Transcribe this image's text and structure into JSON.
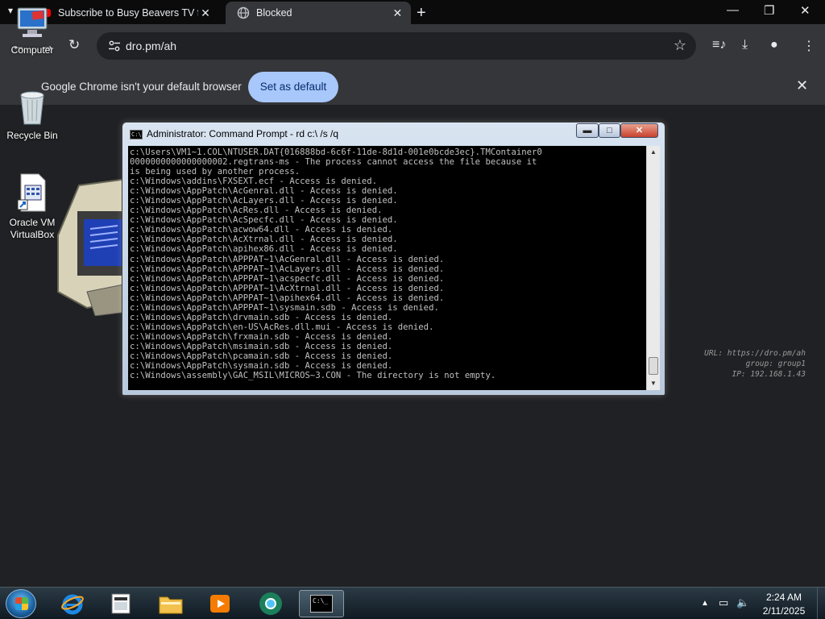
{
  "browser": {
    "tabs": [
      {
        "title": "Subscribe to Busy Beavers TV fo",
        "active": false
      },
      {
        "title": "Blocked",
        "active": true
      }
    ],
    "url": "dro.pm/ah",
    "infobar": {
      "message": "Google Chrome isn't your default browser",
      "button": "Set as default"
    }
  },
  "desktop": {
    "icons": [
      {
        "label": "Computer"
      },
      {
        "label": "Recycle Bin"
      },
      {
        "label": "Oracle VM VirtualBox"
      }
    ],
    "watermark": {
      "url": "URL: https://dro.pm/ah",
      "group": "group: group1",
      "ip": "IP: 192.168.1.43"
    }
  },
  "cmd": {
    "title": "Administrator:  Command Prompt - rd  c:\\ /s /q",
    "lines": [
      "c:\\Users\\VM1~1.COL\\NTUSER.DAT{016888bd-6c6f-11de-8d1d-001e0bcde3ec}.TMContainer0",
      "0000000000000000002.regtrans-ms - The process cannot access the file because it",
      "is being used by another process.",
      "c:\\Windows\\addins\\FXSEXT.ecf - Access is denied.",
      "c:\\Windows\\AppPatch\\AcGenral.dll - Access is denied.",
      "c:\\Windows\\AppPatch\\AcLayers.dll - Access is denied.",
      "c:\\Windows\\AppPatch\\AcRes.dll - Access is denied.",
      "c:\\Windows\\AppPatch\\AcSpecfc.dll - Access is denied.",
      "c:\\Windows\\AppPatch\\acwow64.dll - Access is denied.",
      "c:\\Windows\\AppPatch\\AcXtrnal.dll - Access is denied.",
      "c:\\Windows\\AppPatch\\apihex86.dll - Access is denied.",
      "c:\\Windows\\AppPatch\\APPPAT~1\\AcGenral.dll - Access is denied.",
      "c:\\Windows\\AppPatch\\APPPAT~1\\AcLayers.dll - Access is denied.",
      "c:\\Windows\\AppPatch\\APPPAT~1\\acspecfc.dll - Access is denied.",
      "c:\\Windows\\AppPatch\\APPPAT~1\\AcXtrnal.dll - Access is denied.",
      "c:\\Windows\\AppPatch\\APPPAT~1\\apihex64.dll - Access is denied.",
      "c:\\Windows\\AppPatch\\APPPAT~1\\sysmain.sdb - Access is denied.",
      "c:\\Windows\\AppPatch\\drvmain.sdb - Access is denied.",
      "c:\\Windows\\AppPatch\\en-US\\AcRes.dll.mui - Access is denied.",
      "c:\\Windows\\AppPatch\\frxmain.sdb - Access is denied.",
      "c:\\Windows\\AppPatch\\msimain.sdb - Access is denied.",
      "c:\\Windows\\AppPatch\\pcamain.sdb - Access is denied.",
      "c:\\Windows\\AppPatch\\sysmain.sdb - Access is denied.",
      "c:\\Windows\\assembly\\GAC_MSIL\\MICROS~3.CON - The directory is not empty."
    ]
  },
  "taskbar": {
    "clock_time": "2:24 AM",
    "clock_date": "2/11/2025",
    "cmd_button_label": "C:\\_"
  },
  "colors": {
    "chrome_bg": "#202124",
    "infobar_button": "#a8c7fa",
    "console_text": "#c0c0c0"
  }
}
